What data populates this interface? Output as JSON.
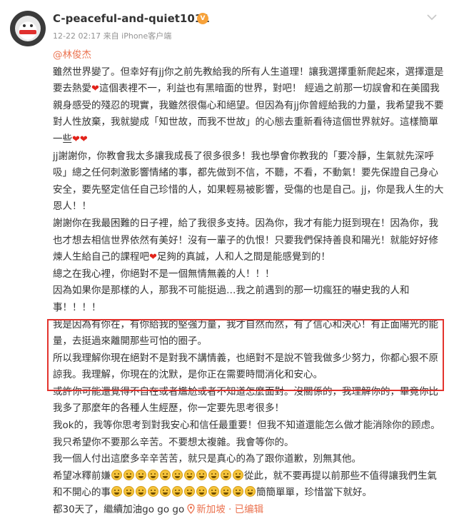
{
  "post": {
    "username": "C-peaceful-and-quiet1011",
    "timestamp": "12-22 02:17",
    "source": "来自 iPhone客户端",
    "mention": "@林俊杰",
    "badge_icon": "vip-badge-icon",
    "accent_color": "#eb7350",
    "highlight_color": "#e3332d"
  },
  "content": {
    "p1a": "雖然世界變了。但幸好有jj你之前先教給我的所有人生道理！讓我選擇重新爬起來，選擇還是要去熱愛",
    "p1b": "這個表裡不一，利益也有黑暗面的世界，對吧！ 經過之前那一切誤會和在美國我親身感受的殘忍的現實，我雖然很傷心和絕望。但因為有jj你曾經給我的力量，我希望我不要對人性放棄，我就變成「知世故，而我不世故」的心態去重新看待這個世界就好。這樣簡單一些",
    "p2": "jj謝謝你，你教會我太多讓我成長了很多很多！我也學會你教我的「要冷靜，生氣就先深呼吸」總之任何刺激影響情緒的事，都先做到不信，不聽，不看，不動氣！要先保證自己身心安全，要先堅定信任自己珍惜的人，如果輕易被影響，受傷的也是自己。jj，你是我人生的大恩人！！",
    "p3a": "謝謝你在我最困難的日子裡，給了我很多支持。因為你，我才有能力挺到現在！因為你，我也才想去相信世界依然有美好！沒有一輩子的仇恨！只要我們保持善良和陽光！就能好好修煉人生給自己的課程吧",
    "p3b": "足夠的真誠，人和人之間是能感覺到的！",
    "p4": "總之在我心裡，你絕對不是一個無情無義的人！！！",
    "p5": "因為如果你是那樣的人，那我不可能挺過…我之前遇到的那一切瘋狂的嚇史我的人和事！！！！",
    "p6": "我是因為有你在，有你給我的堅強力量，我才自然而然，有了信心和決心！有正面陽光的能量，去挺過來離開那些可怕的圈子。",
    "p7": "所以我理解你現在絕對不是對我不講情義，也絕對不是說不管我做多少努力，你都心狠不原諒我。我理解，你現在的沈默，是你正在需要時間消化和安心。",
    "p8": "或許你可能還覺得不自在或者尷尬或者不知道怎麼面對。沒關係的，我理解你的，畢竟你比我多了那麼年的各種人生經歷，你一定要先思考很多！",
    "p9": "我ok的，我等你思考到對我安心和信任最重要！但我不知道還能怎么做才能消除你的顾虑。我只希望你不要那么辛苦。不要想太複雜。我會等你的。",
    "p10": "我一個人付出這麼多辛辛苦苦，就只是真心的為了跟你道歉，別無其他。",
    "p11a": "希望冰釋前嫌",
    "p11b": "從此，就不要再提以前那些不值得讓我們生氣和不開心的事",
    "p11c": "簡簡單單，珍惜當下就好。",
    "p12": "都30天了，繼續加油go go go",
    "location": "新加坡 · 已编辑",
    "heart_symbol": "❤"
  }
}
